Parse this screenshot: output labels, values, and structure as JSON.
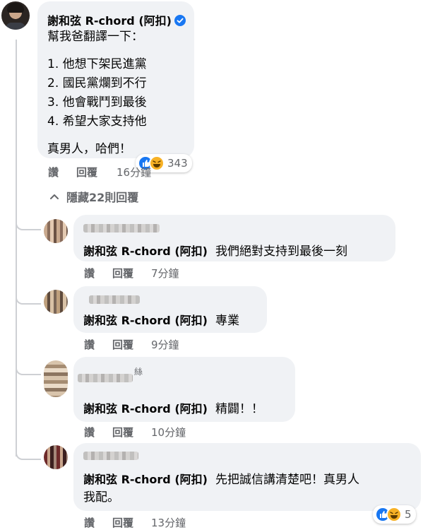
{
  "main_comment": {
    "author": "謝和弦 R-chord (阿扣)",
    "lines": [
      "幫我爸翻譯一下：",
      "1. 他想下架民進黨",
      "2. 國民黨爛到不行",
      "3. 他會戰鬥到最後",
      "4. 希望大家支持他",
      "真男人，哈們！"
    ],
    "reaction_count": "343",
    "actions": {
      "like": "讚",
      "reply": "回覆",
      "time": "16分鐘"
    }
  },
  "hide_replies": "隱藏22則回覆",
  "replies": [
    {
      "author": "謝和弦 R-chord (阿扣)",
      "text": "我們絕對支持到最後一刻",
      "actions": {
        "like": "讚",
        "reply": "回覆",
        "time": "7分鐘"
      }
    },
    {
      "author": "謝和弦 R-chord (阿扣)",
      "text": "專業",
      "actions": {
        "like": "讚",
        "reply": "回覆",
        "time": "9分鐘"
      }
    },
    {
      "author": "謝和弦 R-chord (阿扣)",
      "text": "精闢！！",
      "badge_char": "絲",
      "actions": {
        "like": "讚",
        "reply": "回覆",
        "time": "10分鐘"
      }
    },
    {
      "author": "謝和弦 R-chord (阿扣)",
      "text_line1": "先把誠信講清楚吧！真男人",
      "text_line2": "我配。",
      "reaction_count": "5",
      "actions": {
        "like": "讚",
        "reply": "回覆",
        "time": "13分鐘"
      }
    }
  ],
  "colors": {
    "like_blue": "#1877f2",
    "haha_yellow": "#f7b125",
    "bubble": "#f0f2f5",
    "meta_gray": "#65676b"
  }
}
